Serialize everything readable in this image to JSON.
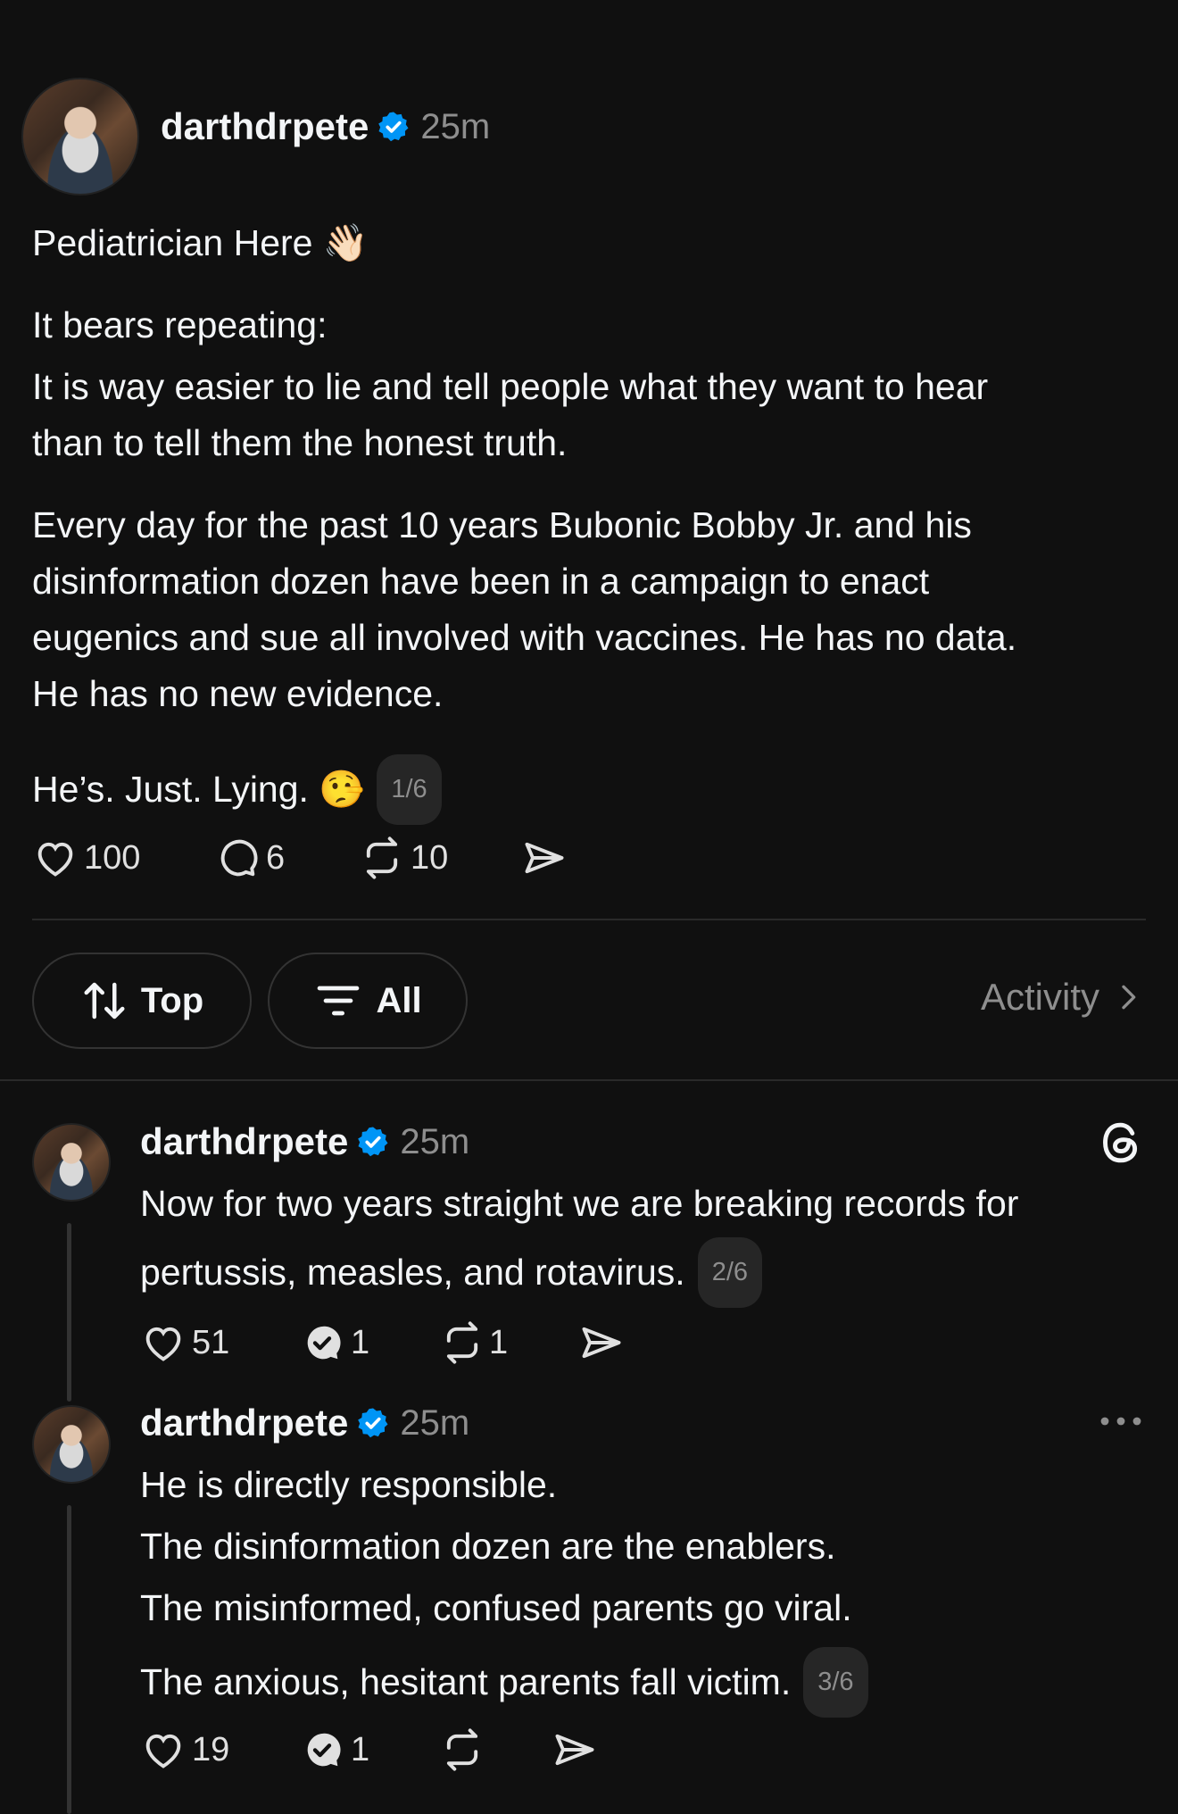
{
  "main_post": {
    "username": "darthdrpete",
    "time": "25m",
    "lines": [
      "Pediatrician Here 👋🏻",
      "It bears repeating:",
      "It is way easier to lie and tell people what they want to hear",
      "than to tell them the honest truth.",
      "Every day for the past 10 years Bubonic Bobby Jr. and his",
      "disinformation dozen have been in a campaign to enact",
      "eugenics and sue all involved with vaccines. He has no data.",
      "He has no new evidence.",
      "He’s. Just. Lying. 🤥"
    ],
    "page_badge": "1/6",
    "likes": "100",
    "comments": "6",
    "reposts": "10"
  },
  "filter_bar": {
    "sort_label": "Top",
    "filter_label": "All",
    "activity_label": "Activity"
  },
  "replies": [
    {
      "username": "darthdrpete",
      "time": "25m",
      "lines": [
        "Now for two years straight we are breaking records for",
        "pertussis, measles, and rotavirus."
      ],
      "page_badge": "2/6",
      "likes": "51",
      "comments": "1",
      "reposts": "1"
    },
    {
      "username": "darthdrpete",
      "time": "25m",
      "lines": [
        "He is directly responsible.",
        "The disinformation dozen are the enablers.",
        "The misinformed, confused parents go viral.",
        "The anxious, hesitant parents fall victim."
      ],
      "page_badge": "3/6",
      "likes": "19",
      "comments": "1"
    }
  ],
  "colors": {
    "background": "#101010",
    "verified": "#0095f6",
    "secondary_text": "#8e8e8e"
  }
}
